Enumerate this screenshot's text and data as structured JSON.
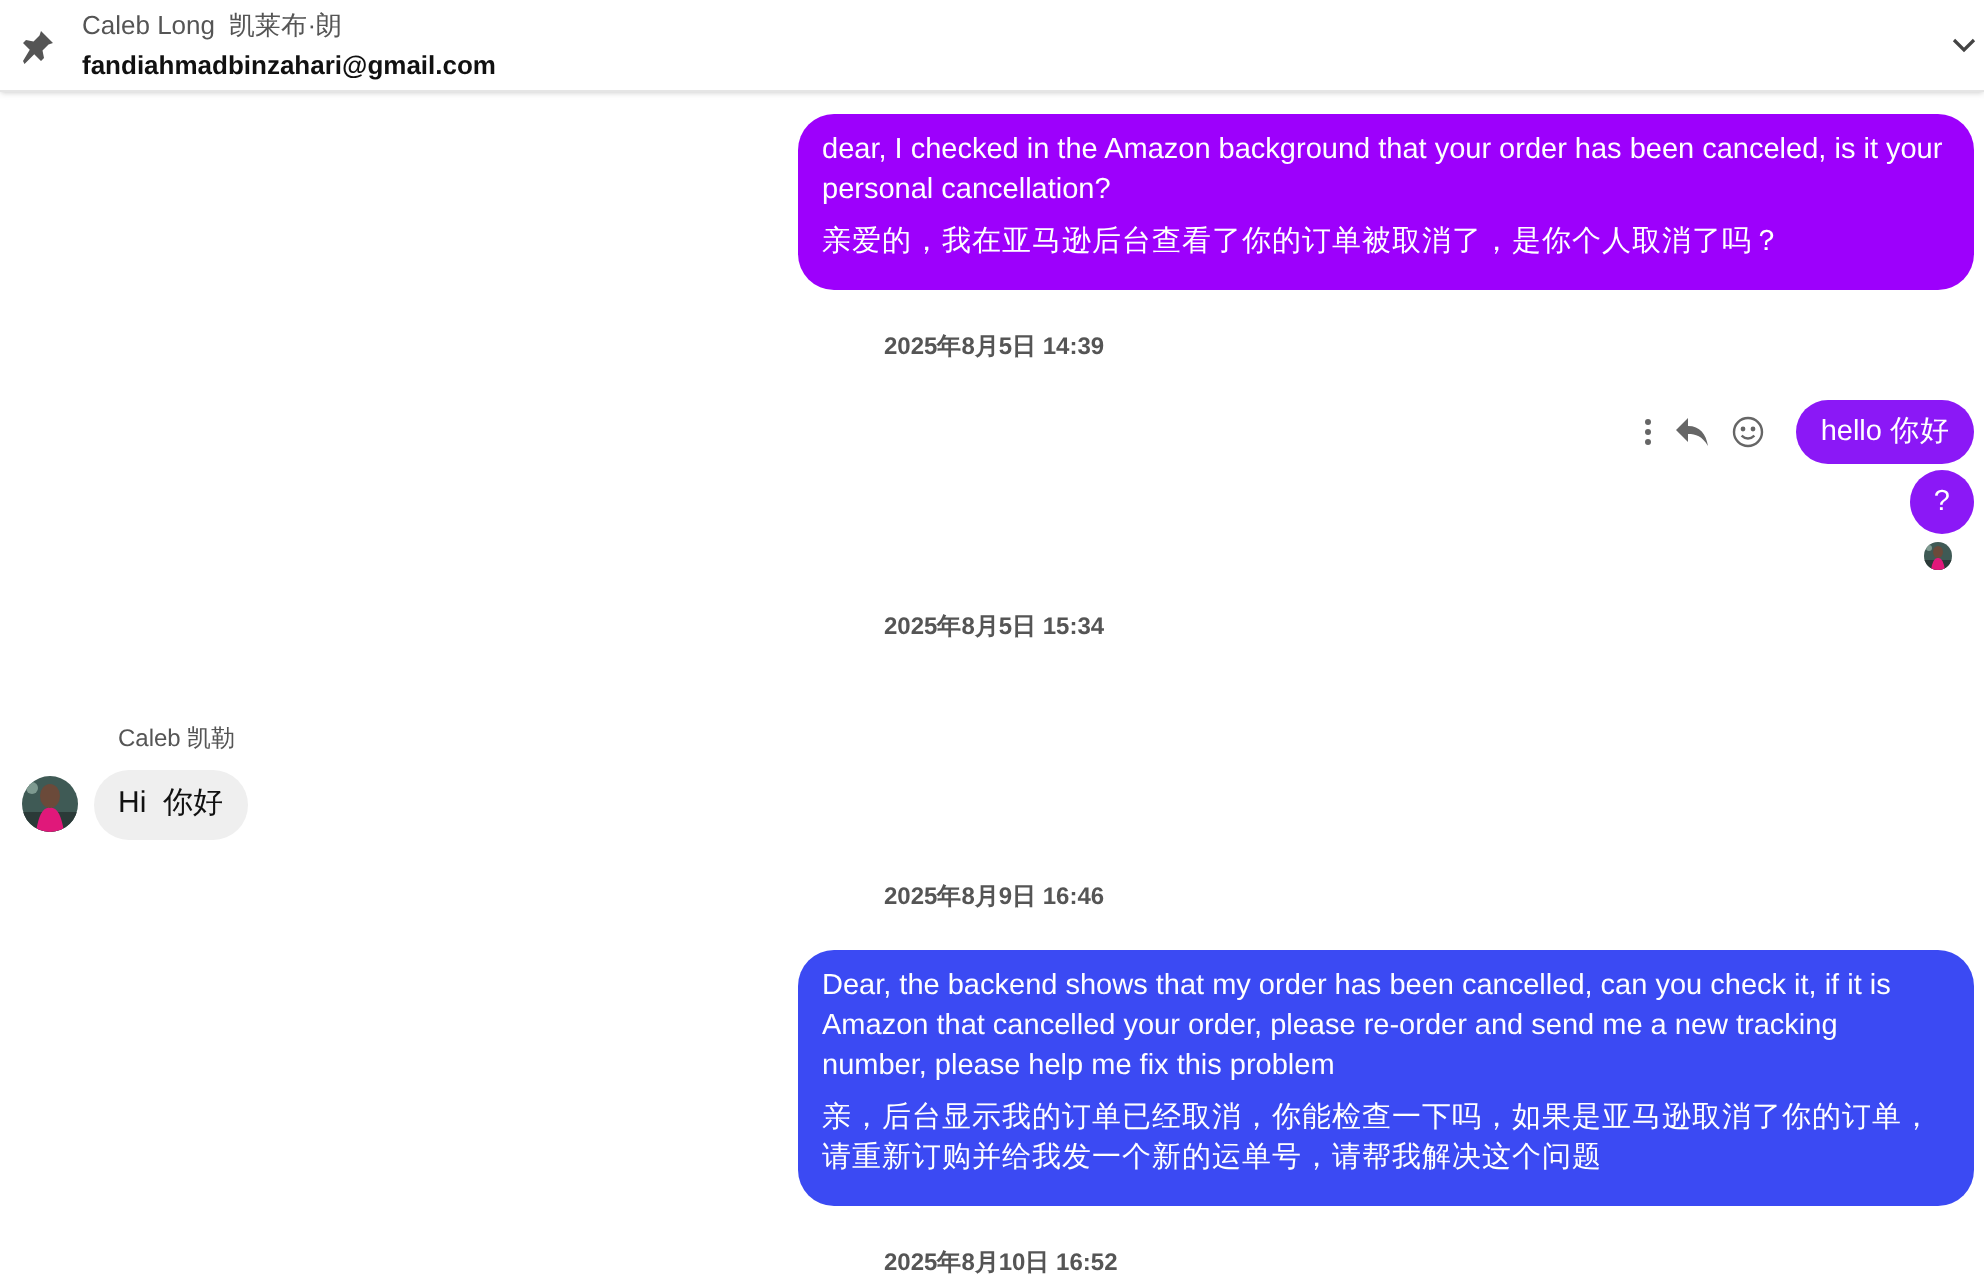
{
  "header": {
    "name": "Caleb Long  凯莱布·朗",
    "email": "fandiahmadbinzahari@gmail.com"
  },
  "messages": [
    {
      "kind": "outgoing",
      "color": "#9d00fc",
      "lines": [
        "dear, I checked in the Amazon background that your order has been canceled, is it your personal cancellation?",
        "亲爱的，我在亚马逊后台查看了你的订单被取消了，是你个人取消了吗？"
      ]
    },
    {
      "kind": "time",
      "text": "2025年8月5日 14:39"
    },
    {
      "kind": "outgoing",
      "color": "#8b18f6",
      "actions": true,
      "lines": [
        "hello  你好"
      ]
    },
    {
      "kind": "outgoing",
      "color": "#8b18f6",
      "lines": [
        "?"
      ]
    },
    {
      "kind": "seen"
    },
    {
      "kind": "time",
      "text": "2025年8月5日 15:34"
    },
    {
      "kind": "incoming",
      "sender": "Caleb  凯勒",
      "lines": [
        "Hi  你好"
      ]
    },
    {
      "kind": "time",
      "text": "2025年8月9日 16:46"
    },
    {
      "kind": "outgoing",
      "color": "#3b4af3",
      "lines": [
        "Dear, the backend shows that my order has been cancelled, can you check it, if it is Amazon that cancelled your order, please re-order and send me a new tracking number, please help me fix this problem",
        "亲，后台显示我的订单已经取消，你能检查一下吗，如果是亚马逊取消了你的订单，请重新订购并给我发一个新的运单号，请帮我解决这个问题"
      ]
    },
    {
      "kind": "time",
      "text": "2025年8月10日 16:52"
    }
  ]
}
